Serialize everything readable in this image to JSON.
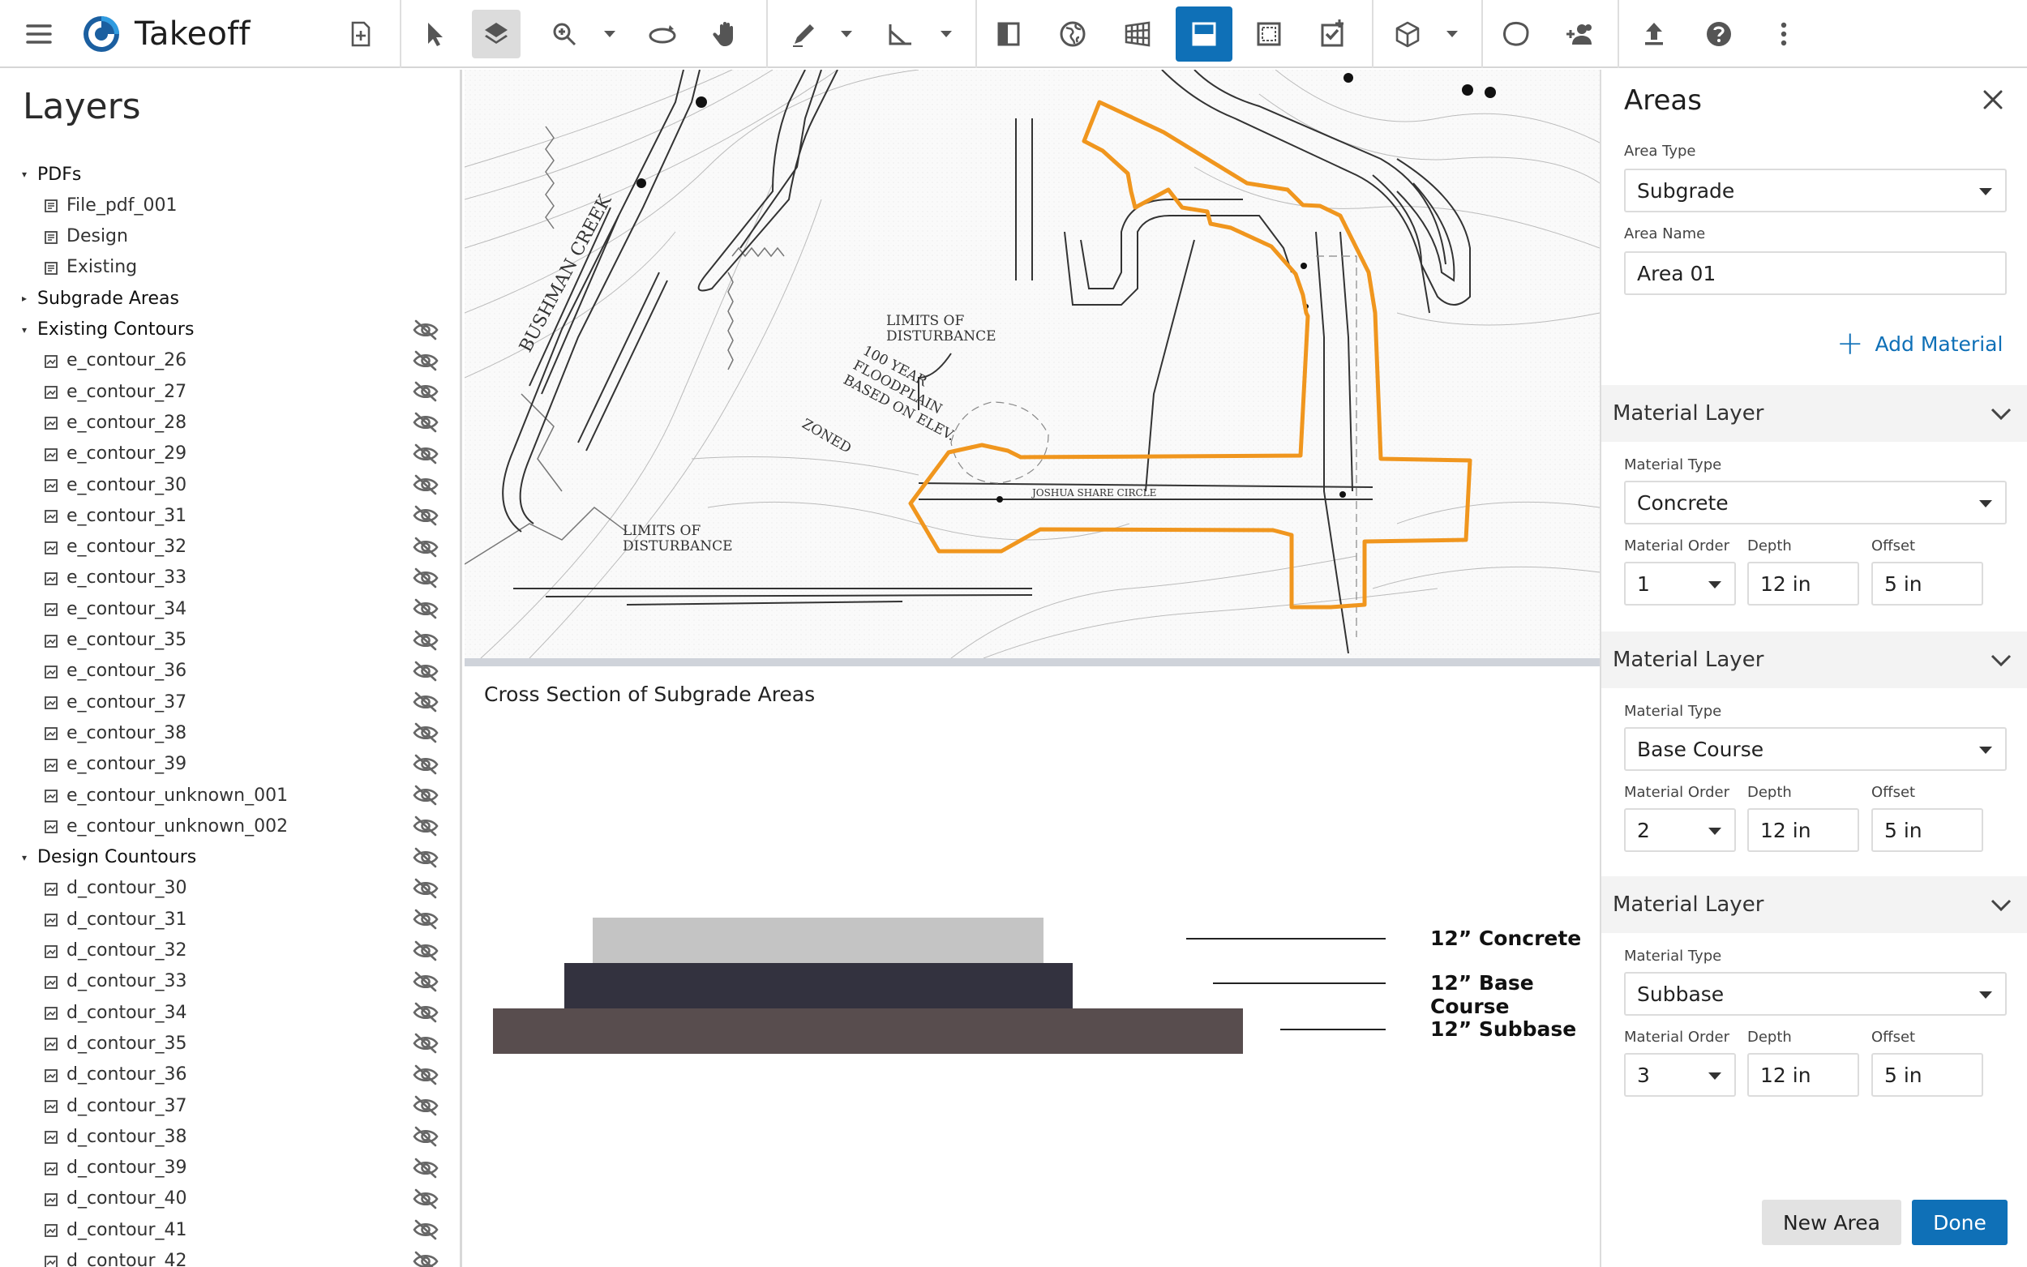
{
  "app": {
    "name": "Takeoff"
  },
  "toolbar": {
    "icons": [
      "menu-icon",
      "add-page-icon",
      "pointer-icon",
      "layers-icon",
      "zoom-icon",
      "rotate-icon",
      "pan-hand-icon",
      "draw-pen-icon",
      "measure-angle-icon",
      "split-view-icon",
      "globe-icon",
      "grid-3d-icon",
      "bottom-panel-icon",
      "area-select-icon",
      "task-check-icon",
      "cube-icon",
      "blob-shape-icon",
      "add-people-icon",
      "upload-icon",
      "help-icon",
      "more-vert-icon"
    ],
    "accent_color": "#0f70b7"
  },
  "layers": {
    "title": "Layers",
    "groups": [
      {
        "label": "PDFs",
        "expanded": true,
        "items": [
          "File_pdf_001",
          "Design",
          "Existing"
        ]
      },
      {
        "label": "Subgrade Areas",
        "expanded": false,
        "items": []
      },
      {
        "label": "Existing Contours",
        "expanded": true,
        "items": [
          "e_contour_26",
          "e_contour_27",
          "e_contour_28",
          "e_contour_29",
          "e_contour_30",
          "e_contour_31",
          "e_contour_32",
          "e_contour_33",
          "e_contour_34",
          "e_contour_35",
          "e_contour_36",
          "e_contour_37",
          "e_contour_38",
          "e_contour_39",
          "e_contour_unknown_001",
          "e_contour_unknown_002"
        ]
      },
      {
        "label": "Design Countours",
        "expanded": true,
        "items": [
          "d_contour_30",
          "d_contour_31",
          "d_contour_32",
          "d_contour_33",
          "d_contour_34",
          "d_contour_35",
          "d_contour_36",
          "d_contour_37",
          "d_contour_38",
          "d_contour_39",
          "d_contour_40",
          "d_contour_41",
          "d_contour_42"
        ]
      }
    ]
  },
  "map": {
    "labels": [
      "LIMITS OF",
      "DISTURBANCE",
      "100 YEAR",
      "FLOODPLAIN",
      "BASED ON ELEV.",
      "ZONED",
      "LIMITS OF",
      "DISTURBANCE",
      "BUSHMAN CREEK",
      "JOSHUA SHARE CIRCLE"
    ],
    "outline_color": "#f0961e"
  },
  "cross_section": {
    "title": "Cross Section of Subgrade Areas",
    "layers": [
      {
        "label": "12” Concrete",
        "color": "#c4c4c4"
      },
      {
        "label": "12” Base Course",
        "color": "#33323f"
      },
      {
        "label": "12” Subbase",
        "color": "#584d4e"
      }
    ]
  },
  "areas": {
    "title": "Areas",
    "area_type_label": "Area Type",
    "area_type_value": "Subgrade",
    "area_name_label": "Area Name",
    "area_name_value": "Area 01",
    "add_material_label": "Add Material",
    "material_layers": [
      {
        "header": "Material Layer",
        "type_label": "Material Type",
        "type_value": "Concrete",
        "order_label": "Material Order",
        "order_value": "1",
        "depth_label": "Depth",
        "depth_value": "12 in",
        "offset_label": "Offset",
        "offset_value": "5 in"
      },
      {
        "header": "Material Layer",
        "type_label": "Material Type",
        "type_value": "Base Course",
        "order_label": "Material Order",
        "order_value": "2",
        "depth_label": "Depth",
        "depth_value": "12 in",
        "offset_label": "Offset",
        "offset_value": "5 in"
      },
      {
        "header": "Material Layer",
        "type_label": "Material Type",
        "type_value": "Subbase",
        "order_label": "Material Order",
        "order_value": "3",
        "depth_label": "Depth",
        "depth_value": "12 in",
        "offset_label": "Offset",
        "offset_value": "5 in"
      }
    ],
    "new_area_label": "New Area",
    "done_label": "Done"
  }
}
